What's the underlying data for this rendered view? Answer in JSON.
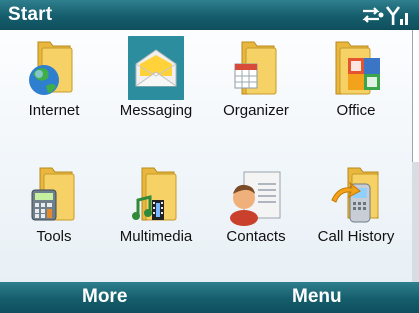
{
  "title": "Start",
  "status": {
    "icons": [
      "sync-icon",
      "signal-icon"
    ]
  },
  "grid": [
    {
      "label": "Internet",
      "icon": "globe-folder-icon"
    },
    {
      "label": "Messaging",
      "icon": "envelope-icon",
      "selected": true
    },
    {
      "label": "Organizer",
      "icon": "calendar-folder-icon"
    },
    {
      "label": "Office",
      "icon": "office-folder-icon"
    },
    {
      "label": "Tools",
      "icon": "calculator-folder-icon"
    },
    {
      "label": "Multimedia",
      "icon": "media-folder-icon"
    },
    {
      "label": "Contacts",
      "icon": "contact-card-icon"
    },
    {
      "label": "Call History",
      "icon": "phone-arrow-icon"
    }
  ],
  "softkeys": {
    "left": "More",
    "right": "Menu"
  },
  "colors": {
    "bar": "#155d6c",
    "selection": "#2c8d9e",
    "folder": "#f2c64a"
  }
}
